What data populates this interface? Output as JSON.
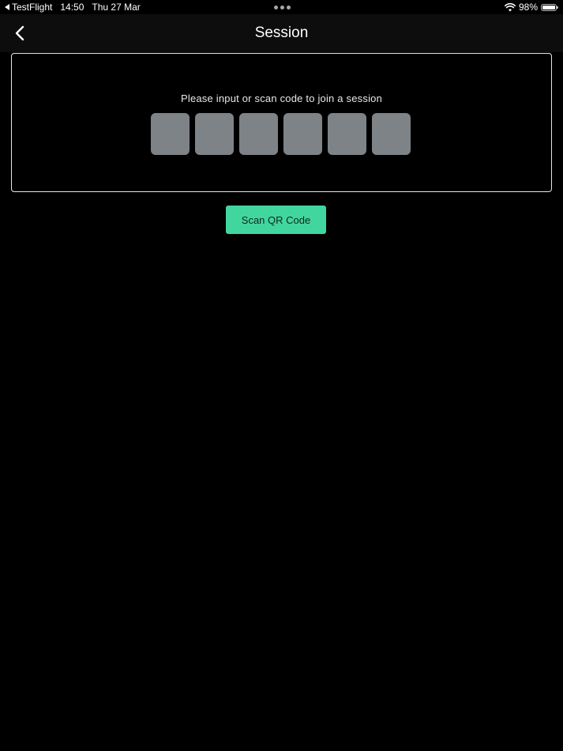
{
  "status_bar": {
    "back_app": "TestFlight",
    "time": "14:50",
    "date": "Thu 27 Mar",
    "battery": "98%",
    "battery_level": 0.98,
    "icons": [
      "back-triangle-icon",
      "wifi-icon",
      "battery-icon"
    ]
  },
  "nav": {
    "title": "Session",
    "back_icon": "chevron-left-icon"
  },
  "session": {
    "prompt": "Please input or scan code to join a session",
    "code_digits": [
      "",
      "",
      "",
      "",
      "",
      ""
    ]
  },
  "actions": {
    "scan_label": "Scan QR Code"
  },
  "colors": {
    "background": "#000000",
    "nav_background": "#0d0d0d",
    "code_box": "#7e8388",
    "accent": "#42d69f",
    "panel_border": "#e6e6e6"
  }
}
